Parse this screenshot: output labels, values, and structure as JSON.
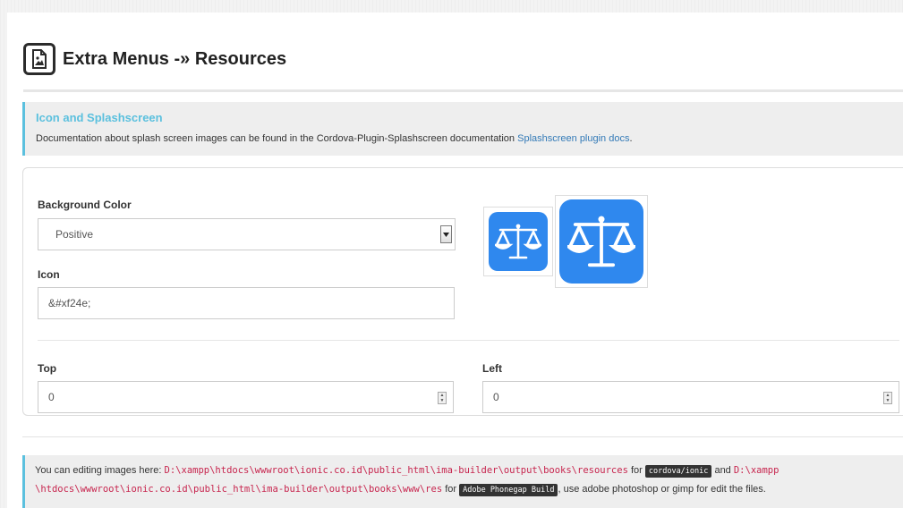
{
  "header": {
    "title": "Extra Menus -» Resources",
    "icon": "image-file-icon"
  },
  "callout": {
    "title": "Icon and Splashscreen",
    "text": "Documentation about splash screen images can be found in the Cordova-Plugin-Splashscreen documentation ",
    "link": "Splashscreen plugin docs",
    "after_link": "."
  },
  "form": {
    "background_color": {
      "label": "Background Color",
      "value": "Positive"
    },
    "icon": {
      "label": "Icon",
      "value": "&#xf24e;"
    },
    "top": {
      "label": "Top",
      "value": "0"
    },
    "left": {
      "label": "Left",
      "value": "0"
    }
  },
  "preview": {
    "icon_symbol": "balance-scale-icon",
    "icon_color": "#2f88ee"
  },
  "footer": {
    "t1": "You can editing images here: ",
    "path1": "D:\\xampp\\htdocs\\wwwroot\\ionic.co.id\\public_html\\ima-builder\\output\\books\\resources",
    "t2": " for ",
    "badge1": "cordova/ionic",
    "t3": " and ",
    "path2a": "D:\\xampp",
    "path2b": "\\htdocs\\wwwroot\\ionic.co.id\\public_html\\ima-builder\\output\\books\\www\\res",
    "t4": " for ",
    "badge2": "Adobe Phonegap Build",
    "t5": ", use adobe photoshop or gimp for edit the files."
  },
  "colors": {
    "accent": "#5bc0de",
    "link": "#337ab7",
    "code": "#c7254e",
    "icon_blue": "#2f88ee"
  }
}
